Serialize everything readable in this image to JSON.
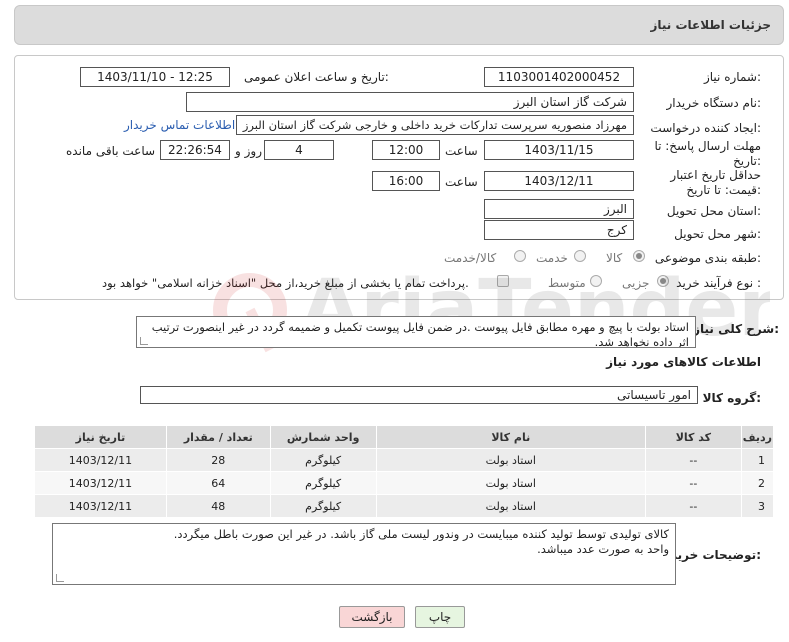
{
  "header": {
    "title": "جزئیات اطلاعات نیاز"
  },
  "fields": {
    "need_number_label": "شماره نیاز:",
    "need_number": "1103001402000452",
    "announce_label": "تاریخ و ساعت اعلان عمومی:",
    "announce_value": "1403/11/10 - 12:25",
    "buyer_org_label": "نام دستگاه خریدار:",
    "buyer_org": "شرکت گاز استان البرز",
    "creator_label": "ایجاد کننده درخواست:",
    "creator": "مهرزاد منصوریه سرپرست تدارکات خرید داخلی و خارجی شرکت گاز استان البرز",
    "contact_link": "اطلاعات تماس خریدار",
    "deadline_label": "مهلت ارسال پاسخ: تا تاریخ:",
    "deadline_date": "1403/11/15",
    "time_label": "ساعت",
    "deadline_time": "12:00",
    "days_value": "4",
    "days_label": "روز و",
    "remaining_time": "22:26:54",
    "remaining_label": "ساعت باقی مانده",
    "validity_label": "حداقل تاریخ اعتبار قیمت: تا تاریخ:",
    "validity_date": "1403/12/11",
    "validity_time": "16:00",
    "province_label": "استان محل تحویل:",
    "province": "البرز",
    "city_label": "شهر محل تحویل:",
    "city": "کرج",
    "category_label": "طبقه بندی موضوعی:",
    "category_options": [
      "کالا",
      "خدمت",
      "کالا/خدمت"
    ],
    "process_label": "نوع فرآیند خرید :",
    "process_options": [
      "جزیی",
      "متوسط"
    ],
    "payment_note": "پرداخت تمام یا بخشی از مبلغ خرید،از محل \"اسناد خزانه اسلامی\" خواهد بود."
  },
  "description": {
    "label": "شرح کلی نیاز:",
    "text": "استاد بولت با پیچ و مهره مطابق فایل پیوست .در ضمن فایل پیوست تکمیل و ضمیمه گردد در غیر اینصورت ترتیب اثر داده نخواهد شد."
  },
  "goods_section_title": "اطلاعات کالاهای مورد نیاز",
  "goods_group": {
    "label": "گروه کالا:",
    "value": "امور تاسیساتی"
  },
  "table": {
    "headers": [
      "ردیف",
      "کد کالا",
      "نام کالا",
      "واحد شمارش",
      "تعداد / مقدار",
      "تاریخ نیاز"
    ],
    "rows": [
      [
        "1",
        "--",
        "استاد بولت",
        "کیلوگرم",
        "28",
        "1403/12/11"
      ],
      [
        "2",
        "--",
        "استاد بولت",
        "کیلوگرم",
        "64",
        "1403/12/11"
      ],
      [
        "3",
        "--",
        "استاد بولت",
        "کیلوگرم",
        "48",
        "1403/12/11"
      ]
    ]
  },
  "buyer_notes": {
    "label": "توضیحات خریدار:",
    "line1": "کالای تولیدی توسط تولید کننده میبایست در وندور لیست ملی گاز باشد. در غیر این صورت باطل میگردد.",
    "line2": "واحد به صورت عدد میباشد."
  },
  "buttons": {
    "print": "چاپ",
    "back": "بازگشت"
  },
  "watermark_text": "AriaTender.neT",
  "colors": {
    "link": "#2a5db0",
    "back_button": "#f9d6d6",
    "print_button": "#e6f5e0"
  }
}
